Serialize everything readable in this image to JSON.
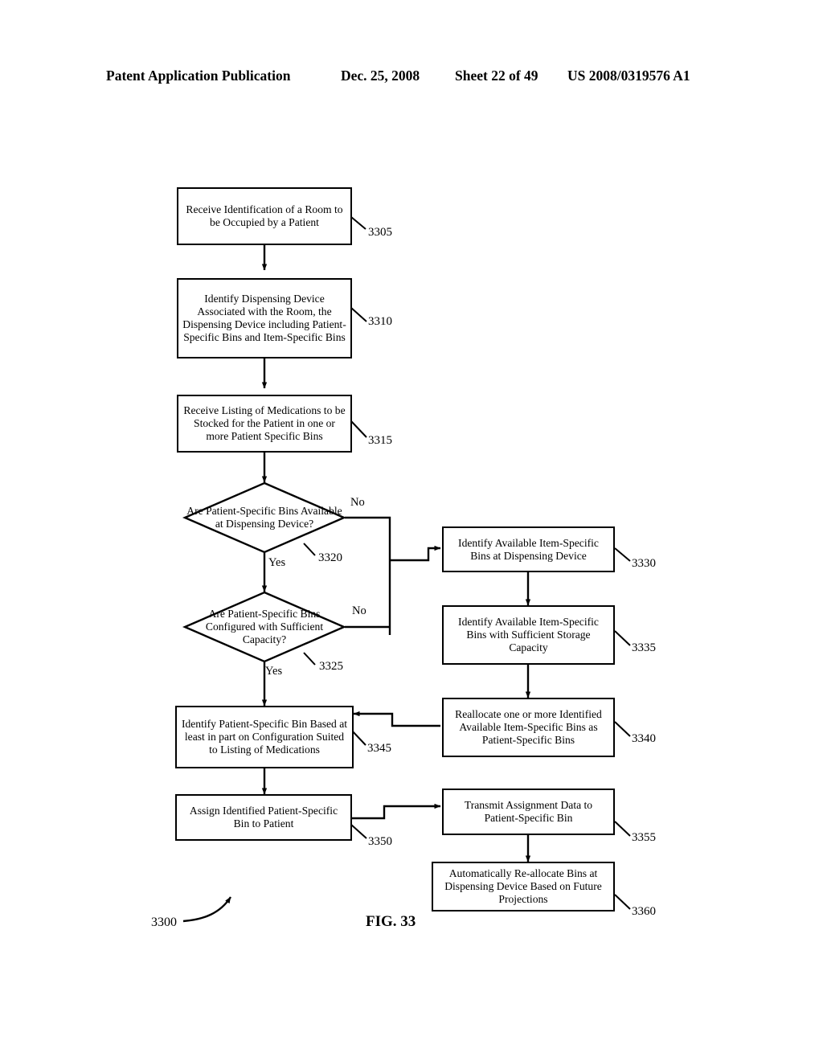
{
  "header": {
    "publication": "Patent Application Publication",
    "date": "Dec. 25, 2008",
    "sheet": "Sheet 22 of 49",
    "patent_number": "US 2008/0319576 A1"
  },
  "figure": {
    "caption": "FIG.  33",
    "flow_ref": "3300"
  },
  "chart_data": {
    "type": "diagram",
    "title": "FIG. 33",
    "diagram_kind": "flowchart",
    "flow_ref": "3300",
    "nodes": [
      {
        "ref": "3305",
        "shape": "process",
        "text": "Receive Identification of a Room to be Occupied by a Patient"
      },
      {
        "ref": "3310",
        "shape": "process",
        "text": "Identify Dispensing Device Associated with the Room, the Dispensing Device including Patient-Specific Bins and Item-Specific Bins"
      },
      {
        "ref": "3315",
        "shape": "process",
        "text": "Receive Listing of Medications to be Stocked for the Patient in one or more Patient Specific Bins"
      },
      {
        "ref": "3320",
        "shape": "decision",
        "text": "Are Patient-Specific Bins Available at Dispensing Device?"
      },
      {
        "ref": "3325",
        "shape": "decision",
        "text": "Are Patient-Specific Bins Configured with Sufficient Capacity?"
      },
      {
        "ref": "3330",
        "shape": "process",
        "text": "Identify Available Item-Specific Bins at Dispensing Device"
      },
      {
        "ref": "3335",
        "shape": "process",
        "text": "Identify Available Item-Specific Bins with Sufficient Storage Capacity"
      },
      {
        "ref": "3340",
        "shape": "process",
        "text": "Reallocate one or more Identified Available Item-Specific Bins as Patient-Specific Bins"
      },
      {
        "ref": "3345",
        "shape": "process",
        "text": "Identify Patient-Specific Bin Based at least in part on Configuration Suited to Listing of Medications"
      },
      {
        "ref": "3350",
        "shape": "process",
        "text": "Assign Identified Patient-Specific Bin to Patient"
      },
      {
        "ref": "3355",
        "shape": "process",
        "text": "Transmit Assignment Data to Patient-Specific Bin"
      },
      {
        "ref": "3360",
        "shape": "process",
        "text": "Automatically Re-allocate Bins at Dispensing Device Based on Future Projections"
      }
    ],
    "edges": [
      {
        "from": "3305",
        "to": "3310",
        "label": ""
      },
      {
        "from": "3310",
        "to": "3315",
        "label": ""
      },
      {
        "from": "3315",
        "to": "3320",
        "label": ""
      },
      {
        "from": "3320",
        "to": "3325",
        "label": "Yes"
      },
      {
        "from": "3320",
        "to": "3330",
        "label": "No"
      },
      {
        "from": "3325",
        "to": "3345",
        "label": "Yes"
      },
      {
        "from": "3325",
        "to": "3330",
        "label": "No"
      },
      {
        "from": "3330",
        "to": "3335",
        "label": ""
      },
      {
        "from": "3335",
        "to": "3340",
        "label": ""
      },
      {
        "from": "3340",
        "to": "3345",
        "label": ""
      },
      {
        "from": "3345",
        "to": "3350",
        "label": ""
      },
      {
        "from": "3350",
        "to": "3355",
        "label": ""
      },
      {
        "from": "3355",
        "to": "3360",
        "label": ""
      }
    ],
    "branch_labels": {
      "d3320_yes": "Yes",
      "d3320_no": "No",
      "d3325_yes": "Yes",
      "d3325_no": "No"
    }
  }
}
